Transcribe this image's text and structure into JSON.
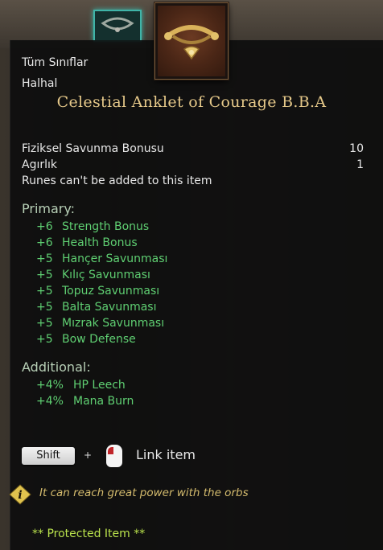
{
  "tooltip": {
    "class_label": "Tüm Sınıflar",
    "item_type": "Halhal",
    "item_name": "Celestial Anklet of Courage B.B.A",
    "base_stats": [
      {
        "label": "Fiziksel Savunma Bonusu",
        "value": "10"
      },
      {
        "label": "Agırlık",
        "value": "1"
      }
    ],
    "rune_note": "Runes can't be added to this item",
    "primary_header": "Primary:",
    "primary_stats": [
      {
        "amount": "+6",
        "name": "Strength Bonus"
      },
      {
        "amount": "+6",
        "name": "Health Bonus"
      },
      {
        "amount": "+5",
        "name": "Hançer Savunması"
      },
      {
        "amount": "+5",
        "name": "Kılıç Savunması"
      },
      {
        "amount": "+5",
        "name": "Topuz Savunması"
      },
      {
        "amount": "+5",
        "name": "Balta Savunması"
      },
      {
        "amount": "+5",
        "name": "Mızrak Savunması"
      },
      {
        "amount": "+5",
        "name": "Bow Defense"
      }
    ],
    "additional_header": "Additional:",
    "additional_stats": [
      {
        "amount": "+4%",
        "name": "HP Leech"
      },
      {
        "amount": "+4%",
        "name": "Mana Burn"
      }
    ],
    "shortcut": {
      "key": "Shift",
      "plus": "+",
      "action": "Link item"
    },
    "hint": "It can reach great power with the orbs",
    "protected": "** Protected Item **"
  },
  "icons": {
    "item": "anklet-icon",
    "slot": "anklet-slot-icon",
    "mouse": "mouse-left-click-icon",
    "info": "info-icon"
  },
  "colors": {
    "title": "#e6c98a",
    "stat_green": "#5fcf72",
    "hint": "#d4bb6d",
    "protected": "#b9e24c",
    "slot_highlight": "#3fb4a8"
  }
}
